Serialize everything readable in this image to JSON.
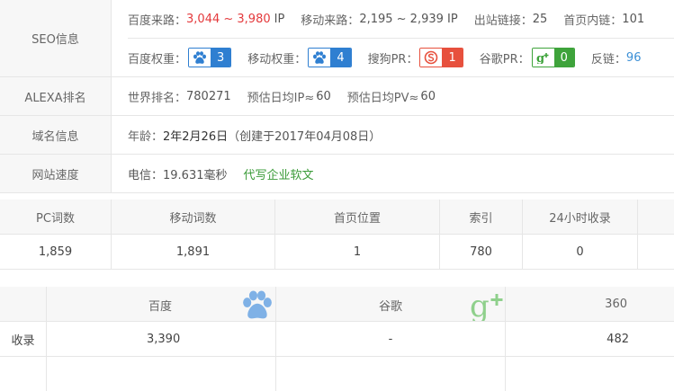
{
  "seo": {
    "label": "SEO信息",
    "row1": {
      "baidu_traffic_label": "百度来路：",
      "baidu_traffic_value": "3,044 ~ 3,980",
      "baidu_traffic_unit": "IP",
      "mobile_traffic_label": "移动来路：",
      "mobile_traffic_value": "2,195 ~ 2,939 IP",
      "outbound_label": "出站链接：",
      "outbound_value": "25",
      "homepage_links_label": "首页内链：",
      "homepage_links_value": "101"
    },
    "row2": {
      "baidu_weight_label": "百度权重：",
      "baidu_weight_value": "3",
      "mobile_weight_label": "移动权重：",
      "mobile_weight_value": "4",
      "sogou_pr_label": "搜狗PR：",
      "sogou_pr_value": "1",
      "google_pr_label": "谷歌PR：",
      "google_pr_value": "0",
      "backlinks_label": "反链：",
      "backlinks_value": "96"
    }
  },
  "alexa": {
    "label": "ALEXA排名",
    "world_rank_label": "世界排名：",
    "world_rank_value": "780271",
    "ip_label": "预估日均IP≈",
    "ip_value": "60",
    "pv_label": "预估日均PV≈",
    "pv_value": "60"
  },
  "domain": {
    "label": "域名信息",
    "age_label": "年龄：",
    "age_value": "2年2月26日",
    "created": "（创建于2017年04月08日）"
  },
  "speed": {
    "label": "网站速度",
    "telecom": "电信：19.631毫秒",
    "link": "代写企业软文"
  },
  "words": {
    "headers": [
      "PC词数",
      "移动词数",
      "首页位置",
      "索引",
      "24小时收录",
      ""
    ],
    "values": [
      "1,859",
      "1,891",
      "1",
      "780",
      "0",
      ""
    ]
  },
  "index": {
    "headers": [
      "",
      "百度",
      "谷歌",
      "360"
    ],
    "row_label": "收录",
    "values": [
      "3,390",
      "-",
      "482"
    ]
  },
  "colors": {
    "baidu_blue": "#2f7fd1",
    "sogou_red": "#e7503d",
    "google_green": "#3ea33b",
    "traffic_red": "#e4393c",
    "link_green": "#3a9b38"
  },
  "icons": {
    "baidu": "paw-icon",
    "sogou": "sogou-s-icon",
    "google": "google-plus-icon"
  }
}
